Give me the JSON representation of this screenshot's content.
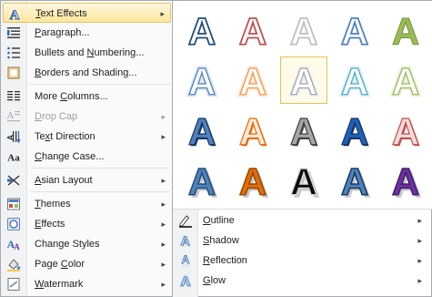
{
  "menu": {
    "items": [
      {
        "label": "Text Effects",
        "icon": "text-effects-icon",
        "submenu": true,
        "highlighted": true
      },
      {
        "label": "Paragraph...",
        "icon": "paragraph-icon",
        "submenu": false
      },
      {
        "label": "Bullets and Numbering...",
        "icon": "bullets-icon",
        "submenu": false
      },
      {
        "label": "Borders and Shading...",
        "icon": "borders-icon",
        "submenu": false
      },
      {
        "label": "More Columns...",
        "icon": "columns-icon",
        "submenu": false
      },
      {
        "label": "Drop Cap",
        "icon": "drop-cap-icon",
        "submenu": true,
        "disabled": true
      },
      {
        "label": "Text Direction",
        "icon": "text-direction-icon",
        "submenu": true
      },
      {
        "label": "Change Case...",
        "icon": "change-case-icon",
        "submenu": false
      },
      {
        "label": "Asian Layout",
        "icon": "asian-layout-icon",
        "submenu": true
      },
      {
        "label": "Themes",
        "icon": "themes-icon",
        "submenu": true
      },
      {
        "label": "Effects",
        "icon": "effects-icon",
        "submenu": true
      },
      {
        "label": "Change Styles",
        "icon": "change-styles-icon",
        "submenu": true
      },
      {
        "label": "Page Color",
        "icon": "page-color-icon",
        "submenu": true
      },
      {
        "label": "Watermark",
        "icon": "watermark-icon",
        "submenu": true
      }
    ],
    "mnemonics": [
      "T",
      "P",
      "N",
      "B",
      "C",
      "D",
      "x",
      "C",
      "A",
      "T",
      "E",
      "g",
      "C",
      "W"
    ],
    "arrow_glyph": "▸"
  },
  "gallery": {
    "glyph": "A",
    "rows": [
      [
        {
          "style": "outline",
          "stroke": "#1f4e79",
          "fill": "#ffffff"
        },
        {
          "style": "outline",
          "stroke": "#c0504d",
          "fill": "#ffffff"
        },
        {
          "style": "outline",
          "stroke": "#bfbfbf",
          "fill": "#ffffff"
        },
        {
          "style": "outline",
          "stroke": "#4f81bd",
          "fill": "#ffffff"
        },
        {
          "style": "solid",
          "stroke": "#76923c",
          "fill": "#9bbb59"
        }
      ],
      [
        {
          "style": "glow",
          "stroke": "#4f81bd",
          "fill": "#dce6f2"
        },
        {
          "style": "glow",
          "stroke": "#f79646",
          "fill": "#fde9d9"
        },
        {
          "style": "glow",
          "stroke": "#a6a6a6",
          "fill": "#f2f2f2"
        },
        {
          "style": "glow",
          "stroke": "#4bacc6",
          "fill": "#ddf0f6"
        },
        {
          "style": "glow",
          "stroke": "#9bbb59",
          "fill": "#ebf1de"
        }
      ],
      [
        {
          "style": "bevel",
          "stroke": "#17375e",
          "fill": "#4f81bd"
        },
        {
          "style": "bevel",
          "stroke": "#e46c0a",
          "fill": "#fde9d9"
        },
        {
          "style": "bevel",
          "stroke": "#404040",
          "fill": "#a6a6a6"
        },
        {
          "style": "bevel",
          "stroke": "#17375e",
          "fill": "#1f5fbf"
        },
        {
          "style": "bevel",
          "stroke": "#c0504d",
          "fill": "#f2dcdb"
        }
      ],
      [
        {
          "style": "shadow",
          "stroke": "#1f4e79",
          "fill": "#4f81bd"
        },
        {
          "style": "shadow",
          "stroke": "#974806",
          "fill": "#e36c0a"
        },
        {
          "style": "shadow",
          "stroke": "#d9d9d9",
          "fill": "#0d0d0d"
        },
        {
          "style": "shadow",
          "stroke": "#17375e",
          "fill": "#4f81bd"
        },
        {
          "style": "shadow",
          "stroke": "#3f1f6b",
          "fill": "#7030a0"
        }
      ]
    ],
    "selected_index": 7
  },
  "submenu": {
    "items": [
      {
        "label": "Outline",
        "icon": "outline-icon"
      },
      {
        "label": "Shadow",
        "icon": "shadow-icon"
      },
      {
        "label": "Reflection",
        "icon": "reflection-icon"
      },
      {
        "label": "Glow",
        "icon": "glow-icon"
      }
    ],
    "arrow_glyph": "▸"
  },
  "colors": {
    "highlight_top": "#fef7df",
    "highlight_bottom": "#fde69c",
    "highlight_border": "#e6c46c",
    "menu_border": "#a7abb0"
  }
}
